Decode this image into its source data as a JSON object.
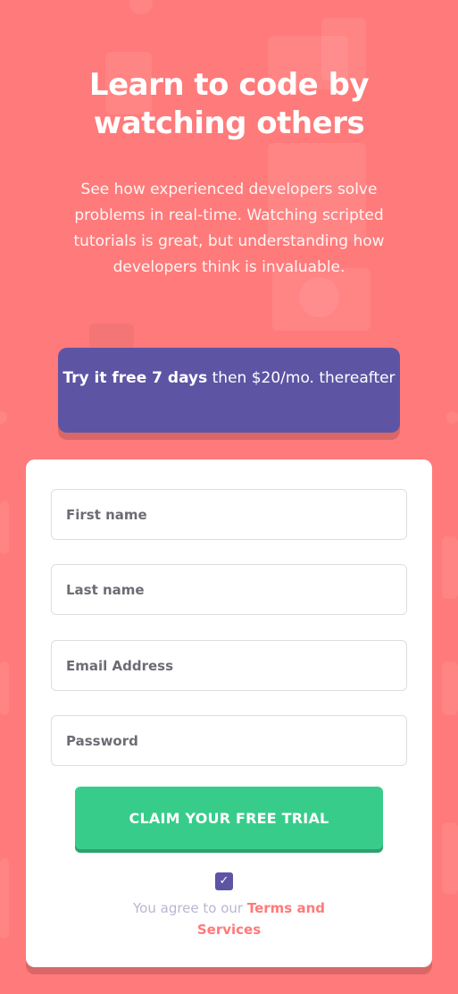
{
  "hero": {
    "title": "Learn to code by watching others",
    "description": "See how experienced developers solve problems in real-time. Watching scripted tutorials is great, but understanding how developers think is invaluable."
  },
  "offer": {
    "bold": "Try it free 7 days",
    "rest": " then $20/mo. thereafter"
  },
  "form": {
    "first_name_placeholder": "First name",
    "last_name_placeholder": "Last name",
    "email_placeholder": "Email Address",
    "password_placeholder": "Password",
    "submit_label": "CLAIM YOUR FREE TRIAL",
    "checkbox_checked": true,
    "agree_text": "You agree to our ",
    "terms_link": "Terms and Services"
  },
  "colors": {
    "background": "#ff7a7a",
    "offer_purple": "#5e54a4",
    "cta_green": "#38cc8b",
    "legal_grey": "#b9b6d3"
  },
  "icons": {
    "checkbox": "checkmark-icon"
  }
}
